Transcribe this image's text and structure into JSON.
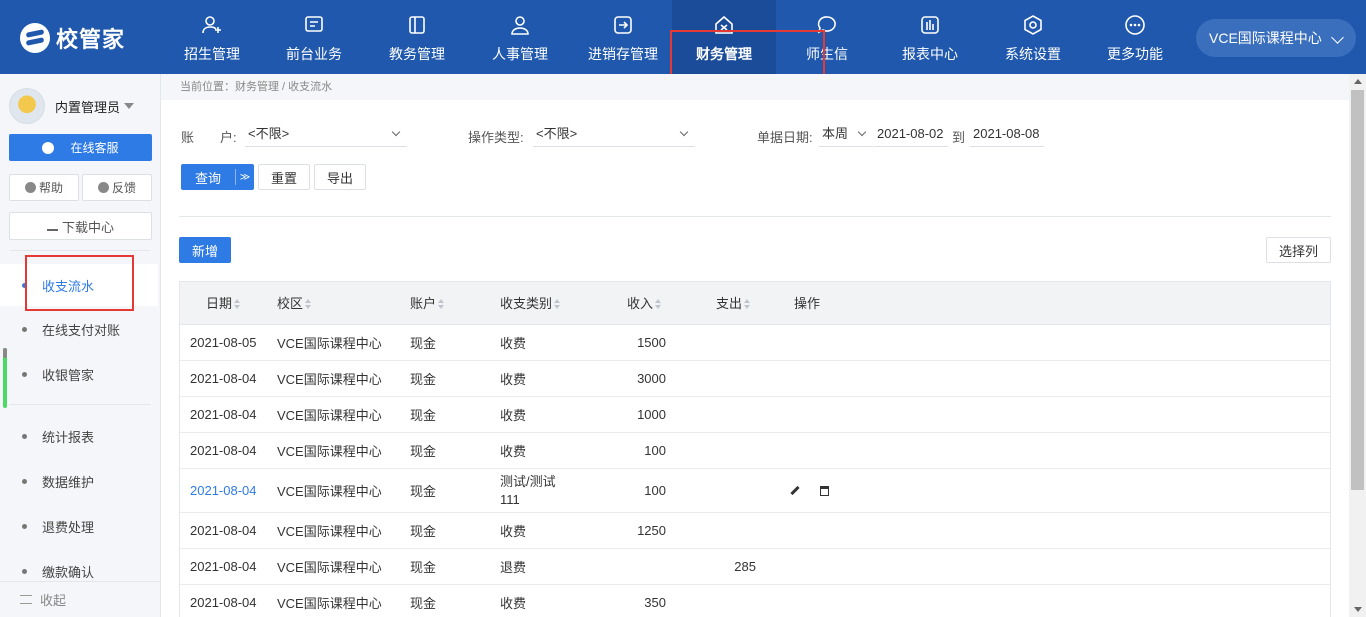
{
  "app": {
    "logo_text": "校管家"
  },
  "nav": [
    {
      "label": "招生管理",
      "icon": "user-plus-icon"
    },
    {
      "label": "前台业务",
      "icon": "monitor-icon"
    },
    {
      "label": "教务管理",
      "icon": "book-icon"
    },
    {
      "label": "人事管理",
      "icon": "person-icon"
    },
    {
      "label": "进销存管理",
      "icon": "transfer-icon"
    },
    {
      "label": "财务管理",
      "icon": "finance-icon",
      "active": true
    },
    {
      "label": "师生信",
      "icon": "chat-icon"
    },
    {
      "label": "报表中心",
      "icon": "chart-icon"
    },
    {
      "label": "系统设置",
      "icon": "settings-icon"
    },
    {
      "label": "更多功能",
      "icon": "more-icon"
    }
  ],
  "school_switch": {
    "label": "VCE国际课程中心"
  },
  "sidebar": {
    "user_name": "内置管理员",
    "service_button": "在线客服",
    "help_button": "帮助",
    "feedback_button": "反馈",
    "download_button": "下载中心",
    "items": [
      {
        "label": "收支流水",
        "active": true
      },
      {
        "label": "在线支付对账"
      },
      {
        "label": "收银管家"
      },
      {
        "label": "统计报表"
      },
      {
        "label": "数据维护"
      },
      {
        "label": "退费处理"
      },
      {
        "label": "缴款确认"
      }
    ],
    "collapse_label": "收起"
  },
  "breadcrumb": "当前位置：财务管理 / 收支流水",
  "filters": {
    "account_label": "账　　户:",
    "account_value": "<不限>",
    "op_type_label": "操作类型:",
    "op_type_value": "<不限>",
    "doc_date_label": "单据日期:",
    "date_period": "本周",
    "date_from": "2021-08-02",
    "date_to_sep": "到",
    "date_to": "2021-08-08"
  },
  "buttons": {
    "query": "查询",
    "query_dropdown": "≫",
    "reset": "重置",
    "export": "导出",
    "add": "新增",
    "choose_columns": "选择列"
  },
  "table": {
    "headers": [
      "日期",
      "校区",
      "账户",
      "收支类别",
      "收入",
      "支出",
      "操作"
    ],
    "rows": [
      {
        "date": "2021-08-05",
        "campus": "VCE国际课程中心",
        "account": "现金",
        "category": "收费",
        "income": "1500",
        "expense": ""
      },
      {
        "date": "2021-08-04",
        "campus": "VCE国际课程中心",
        "account": "现金",
        "category": "收费",
        "income": "3000",
        "expense": ""
      },
      {
        "date": "2021-08-04",
        "campus": "VCE国际课程中心",
        "account": "现金",
        "category": "收费",
        "income": "1000",
        "expense": ""
      },
      {
        "date": "2021-08-04",
        "campus": "VCE国际课程中心",
        "account": "现金",
        "category": "收费",
        "income": "100",
        "expense": ""
      },
      {
        "date": "2021-08-04",
        "campus": "VCE国际课程中心",
        "account": "现金",
        "category": "测试/测试111",
        "income": "100",
        "expense": "",
        "editable": true
      },
      {
        "date": "2021-08-04",
        "campus": "VCE国际课程中心",
        "account": "现金",
        "category": "收费",
        "income": "1250",
        "expense": ""
      },
      {
        "date": "2021-08-04",
        "campus": "VCE国际课程中心",
        "account": "现金",
        "category": "退费",
        "income": "",
        "expense": "285"
      },
      {
        "date": "2021-08-04",
        "campus": "VCE国际课程中心",
        "account": "现金",
        "category": "收费",
        "income": "350",
        "expense": ""
      }
    ]
  }
}
